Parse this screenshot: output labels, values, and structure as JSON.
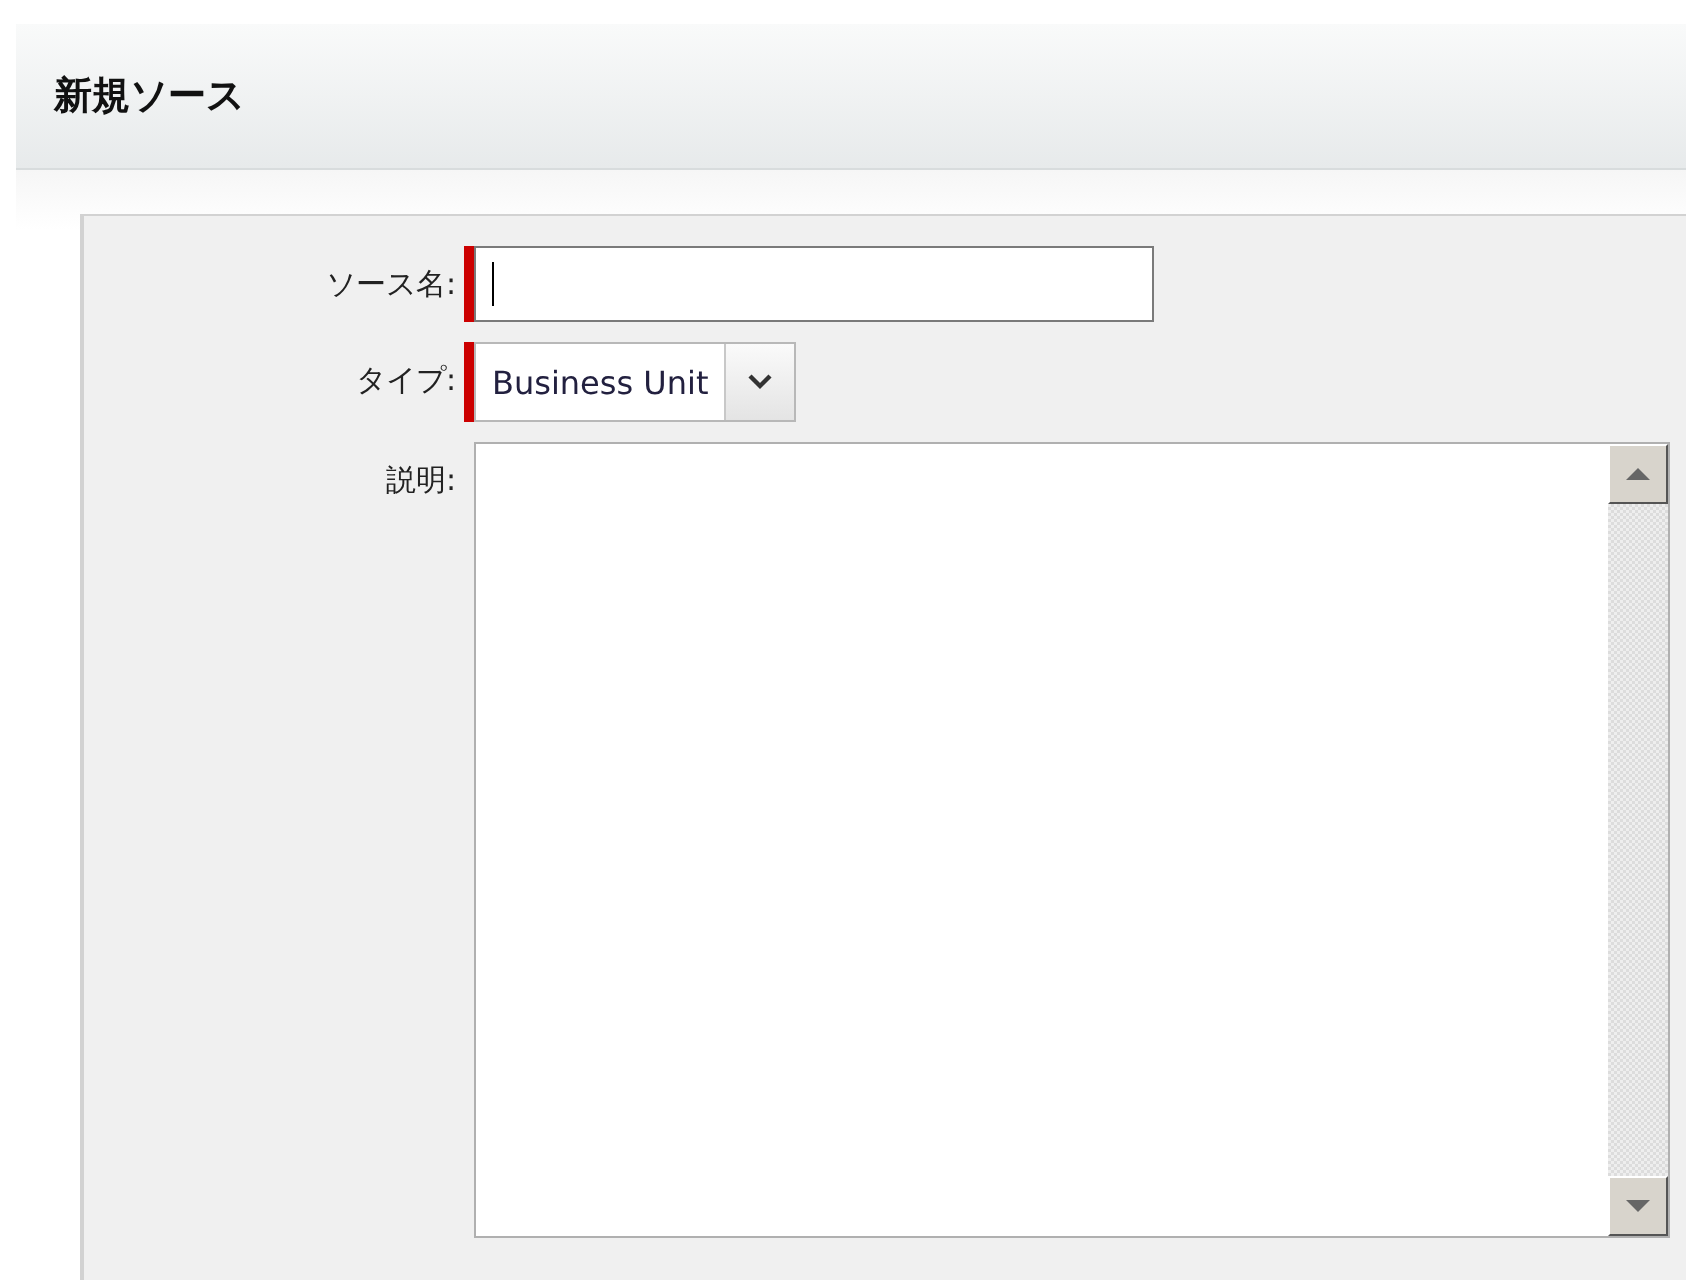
{
  "header": {
    "title": "新規ソース"
  },
  "fields": [
    {
      "kind": "text",
      "label": "ソース名:",
      "required": true,
      "focused": true
    },
    {
      "kind": "select",
      "label": "タイプ:",
      "required": true,
      "value": "Business Unit"
    },
    {
      "kind": "textarea",
      "label": "説明:",
      "required": false
    }
  ]
}
